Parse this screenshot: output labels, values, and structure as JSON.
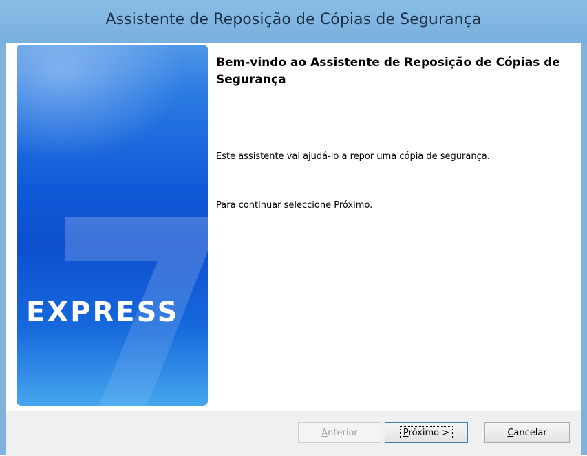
{
  "window": {
    "title": "Assistente de Reposição de Cópias de Segurança"
  },
  "banner": {
    "brand": "EXPRESS"
  },
  "content": {
    "heading": "Bem-vindo ao Assistente de Reposição de Cópias de Segurança",
    "paragraph1": "Este assistente vai ajudá-lo a repor uma cópia de segurança.",
    "paragraph2": "Para continuar seleccione Próximo."
  },
  "buttons": {
    "previous": {
      "label": "Anterior",
      "mnemonic": "A",
      "rest": "nterior",
      "enabled": false
    },
    "next": {
      "label": "Próximo >",
      "mnemonic": "P",
      "rest": "róximo >",
      "enabled": true
    },
    "cancel": {
      "label": "Cancelar",
      "mnemonic": "C",
      "rest": "ancelar",
      "enabled": true
    }
  },
  "colors": {
    "titlebar": "#7fb3de",
    "banner_blue": "#0f5ad8",
    "footer": "#f0f0f0"
  }
}
